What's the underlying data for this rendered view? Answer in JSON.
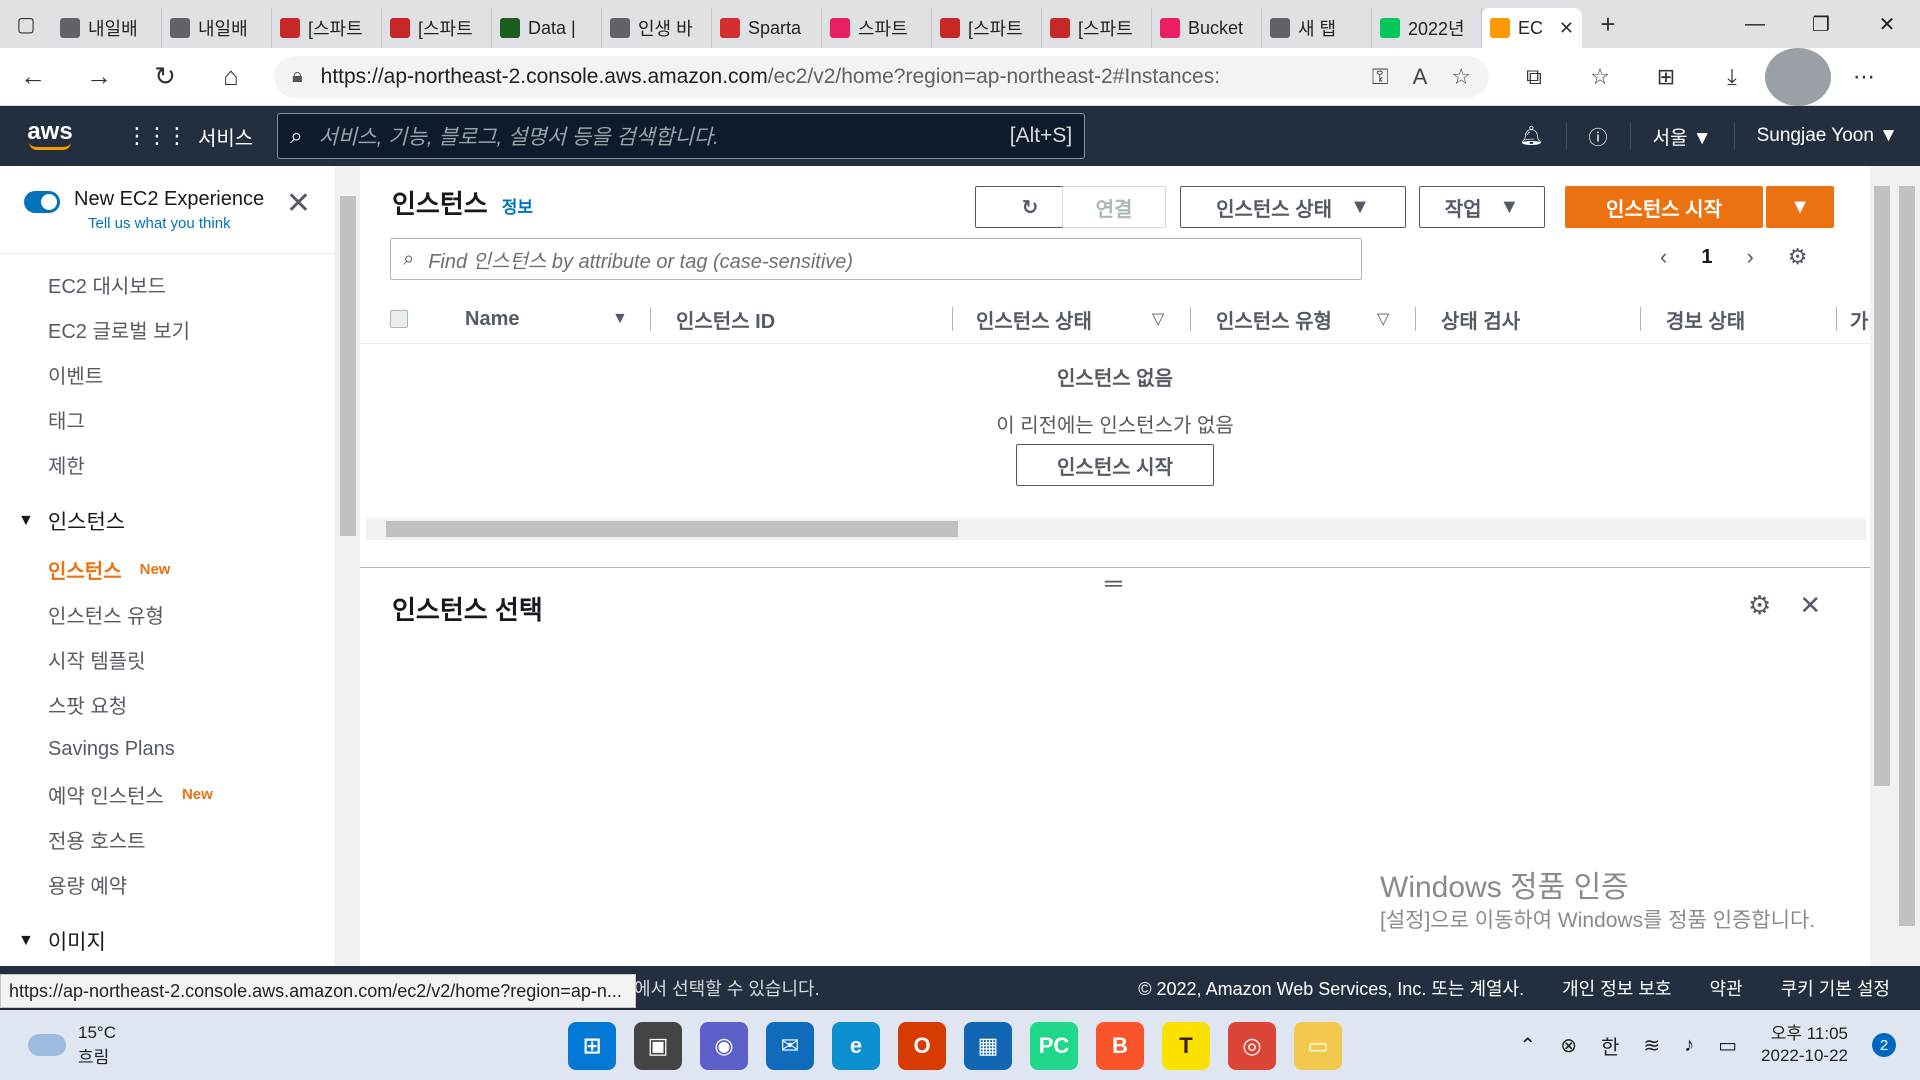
{
  "browser": {
    "tabs": [
      {
        "label": "내일배",
        "color": "#5f6368"
      },
      {
        "label": "내일배",
        "color": "#5f6368"
      },
      {
        "label": "[스파트",
        "color": "#c62828"
      },
      {
        "label": "[스파트",
        "color": "#c62828"
      },
      {
        "label": "Data |",
        "color": "#1b5e20"
      },
      {
        "label": "인생 바",
        "color": "#5f6368"
      },
      {
        "label": "Sparta",
        "color": "#d32f2f"
      },
      {
        "label": "스파트",
        "color": "#e91e63"
      },
      {
        "label": "[스파트",
        "color": "#c62828"
      },
      {
        "label": "[스파트",
        "color": "#c62828"
      },
      {
        "label": "Bucket",
        "color": "#e91e63"
      },
      {
        "label": "새 탭",
        "color": "#5f6368"
      },
      {
        "label": "2022년",
        "color": "#03c75a"
      }
    ],
    "active_tab": {
      "label": "EC",
      "color": "#ff9900"
    },
    "url_host": "https://ap-northeast-2.console.aws.amazon.com",
    "url_path": "/ec2/v2/home?region=ap-northeast-2#Instances:"
  },
  "aws_header": {
    "logo": "aws",
    "services": "서비스",
    "search_placeholder": "서비스, 기능, 블로그, 설명서 등을 검색합니다.",
    "search_hint": "[Alt+S]",
    "region": "서울 ▼",
    "user": "Sungjae Yoon ▼"
  },
  "sidebar": {
    "new_experience_title": "New EC2 Experience",
    "new_experience_sub": "Tell us what you think",
    "top_items": [
      "EC2 대시보드",
      "EC2 글로벌 보기",
      "이벤트",
      "태그",
      "제한"
    ],
    "group_instances": "인스턴스",
    "instance_items": [
      {
        "label": "인스턴스",
        "badge": "New",
        "active": true
      },
      {
        "label": "인스턴스 유형",
        "badge": "",
        "active": false
      },
      {
        "label": "시작 템플릿",
        "badge": "",
        "active": false
      },
      {
        "label": "스팟 요청",
        "badge": "",
        "active": false
      },
      {
        "label": "Savings Plans",
        "badge": "",
        "active": false
      },
      {
        "label": "예약 인스턴스",
        "badge": "New",
        "active": false
      },
      {
        "label": "전용 호스트",
        "badge": "",
        "active": false
      },
      {
        "label": "용량 예약",
        "badge": "",
        "active": false
      }
    ],
    "group_images": "이미지"
  },
  "main": {
    "title": "인스턴스",
    "info": "정보",
    "connect": "연결",
    "state_button": "인스턴스 상태",
    "actions_button": "작업",
    "launch_button": "인스턴스 시작",
    "filter_placeholder": "Find 인스턴스 by attribute or tag (case-sensitive)",
    "page": "1",
    "columns": [
      "Name",
      "인스턴스 ID",
      "인스턴스 상태",
      "인스턴스 유형",
      "상태 검사",
      "경보 상태",
      "가"
    ],
    "empty_title": "인스턴스 없음",
    "empty_sub": "이 리전에는 인스턴스가 없음",
    "empty_button": "인스턴스 시작",
    "lower_title": "인스턴스 선택"
  },
  "watermark": {
    "line1": "Windows 정품 인증",
    "line2": "[설정]으로 이동하여 Windows를 정품 인증합니다."
  },
  "footer": {
    "status_url": "https://ap-northeast-2.console.aws.amazon.com/ec2/v2/home?region=ap-n...",
    "left_text": "에서 선택할 수 있습니다.",
    "copyright": "© 2022, Amazon Web Services, Inc. 또는 계열사.",
    "privacy": "개인 정보 보호",
    "terms": "약관",
    "cookies": "쿠키 기본 설정"
  },
  "taskbar": {
    "temperature": "15°C",
    "weather": "흐림",
    "ime": "한",
    "time": "오후 11:05",
    "date": "2022-10-22",
    "notifications": "2"
  }
}
